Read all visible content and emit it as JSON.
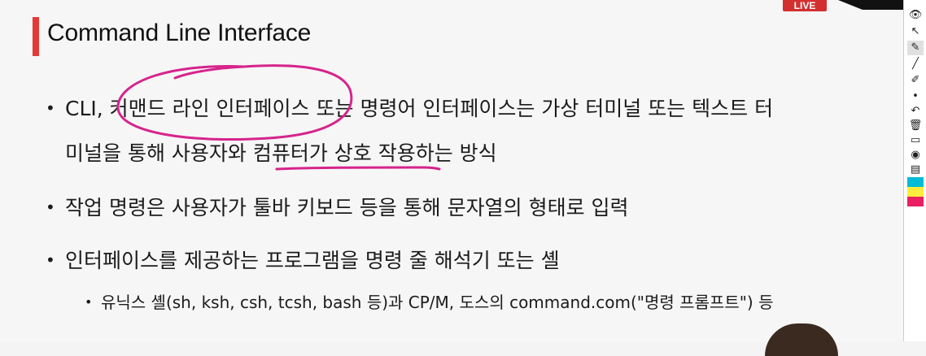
{
  "slide": {
    "title": "Command Line Interface",
    "bullets": [
      {
        "line1": "CLI, 커맨드 라인 인터페이스 또는 명령어 인터페이스는 가상 터미널 또는 텍스트 터",
        "line2": "미널을 통해 사용자와 컴퓨터가 상호 작용하는 방식"
      },
      {
        "line1": "작업 명령은 사용자가 툴바 키보드 등을 통해 문자열의 형태로 입력"
      },
      {
        "line1": "인터페이스를 제공하는 프로그램을 명령 줄 해석기 또는 셸"
      }
    ],
    "sub_bullets": [
      "유닉스 셸(sh, ksh, csh, tcsh, bash 등)과 CP/M, 도스의 command.com(\"명령 프롬프트\") 등"
    ],
    "bullet_glyph": "•"
  },
  "overlay": {
    "live_label": "LIVE"
  },
  "colors": {
    "title_accent": "#e53935",
    "annotation_ink": "#d6248c",
    "slide_bg": "#f6f6f6"
  },
  "toolbar": {
    "tools": [
      "eye-icon",
      "cursor-icon",
      "pen-icon",
      "highlighter-icon",
      "line-icon",
      "eraser-icon",
      "dot-icon",
      "undo-icon",
      "trash-icon",
      "monitor-icon",
      "camera-icon",
      "clipboard-icon"
    ],
    "swatches": [
      "#00bcd4",
      "#ffeb3b",
      "#e91e63",
      "#ff1f8e"
    ]
  }
}
